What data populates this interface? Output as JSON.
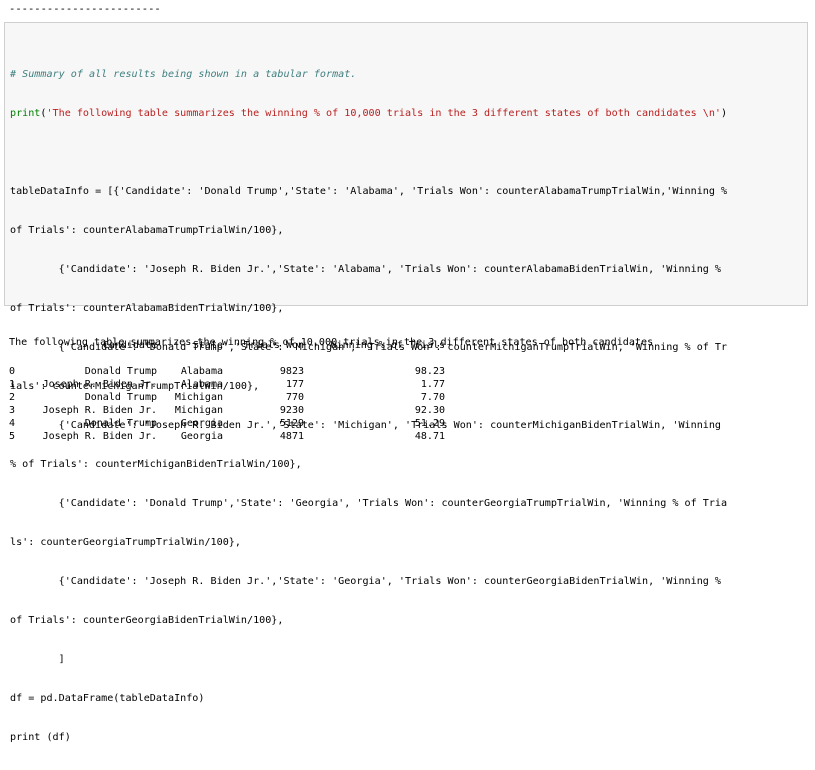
{
  "previous_output": "------------------------",
  "code_cell": {
    "comment": "# Summary of all results being shown in a tabular format.",
    "print_fn": "print",
    "print_arg": "'The following table summarizes the winning % of 10,000 trials in the 3 different states of both candidates \\n'",
    "lines": [
      "tableDataInfo = [{'Candidate': 'Donald Trump','State': 'Alabama', 'Trials Won': counterAlabamaTrumpTrialWin,'Winning %",
      "of Trials': counterAlabamaTrumpTrialWin/100},",
      "        {'Candidate': 'Joseph R. Biden Jr.','State': 'Alabama', 'Trials Won': counterAlabamaBidenTrialWin, 'Winning %",
      "of Trials': counterAlabamaBidenTrialWin/100},",
      "        {'Candidate': 'Donald Trump','State': 'Michigan', 'Trials Won': counterMichiganTrumpTrialWin, 'Winning % of Tr",
      "ials': counterMichiganTrumpTrialWin/100},",
      "        {'Candidate': 'Joseph R. Biden Jr.','State': 'Michigan', 'Trials Won': counterMichiganBidenTrialWin, 'Winning",
      "% of Trials': counterMichiganBidenTrialWin/100},",
      "        {'Candidate': 'Donald Trump','State': 'Georgia', 'Trials Won': counterGeorgiaTrumpTrialWin, 'Winning % of Tria",
      "ls': counterGeorgiaTrumpTrialWin/100},",
      "        {'Candidate': 'Joseph R. Biden Jr.','State': 'Georgia', 'Trials Won': counterGeorgiaBidenTrialWin, 'Winning %",
      "of Trials': counterGeorgiaBidenTrialWin/100},",
      "        ]",
      "df = pd.DataFrame(tableDataInfo)",
      "print (df)"
    ]
  },
  "output": {
    "summary_line": "The following table summarizes the winning % of 10,000 trials in the 3 different states of both candidates",
    "table": {
      "headers": [
        "",
        "Candidate",
        "State",
        "Trials Won",
        "Winning % of Trials"
      ],
      "rows": [
        [
          "0",
          "Donald Trump",
          "Alabama",
          "9823",
          "98.23"
        ],
        [
          "1",
          "Joseph R. Biden Jr.",
          "Alabama",
          "177",
          "1.77"
        ],
        [
          "2",
          "Donald Trump",
          "Michigan",
          "770",
          "7.70"
        ],
        [
          "3",
          "Joseph R. Biden Jr.",
          "Michigan",
          "9230",
          "92.30"
        ],
        [
          "4",
          "Donald Trump",
          "Georgia",
          "5129",
          "51.29"
        ],
        [
          "5",
          "Joseph R. Biden Jr.",
          "Georgia",
          "4871",
          "48.71"
        ]
      ]
    }
  }
}
